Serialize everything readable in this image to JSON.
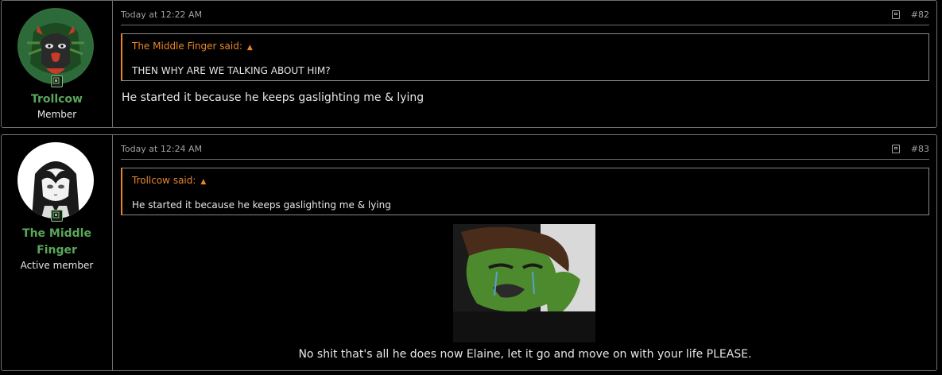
{
  "posts": [
    {
      "timestamp": "Today at 12:22 AM",
      "post_number": "#82",
      "user": {
        "name": "Trollcow",
        "title": "Member"
      },
      "quote": {
        "author": "The Middle Finger said:",
        "text": "THEN WHY ARE WE TALKING ABOUT HIM?"
      },
      "body": "He started it because he keeps gaslighting me & lying"
    },
    {
      "timestamp": "Today at 12:24 AM",
      "post_number": "#83",
      "user": {
        "name_line1": "The Middle",
        "name_line2": "Finger",
        "title": "Active member"
      },
      "quote": {
        "author": "Trollcow said:",
        "text": "He started it because he keeps gaslighting me & lying"
      },
      "body": "No shit that's all he does now Elaine, let it go and move on with your life PLEASE."
    }
  ],
  "colors": {
    "username": "#5aa65a",
    "quote_accent": "#e8852a",
    "border": "#6e6e6e",
    "background": "#000000"
  },
  "icons": {
    "share": "share-icon",
    "quote_jump": "arrow-up-icon",
    "online": "online-status-icon"
  }
}
